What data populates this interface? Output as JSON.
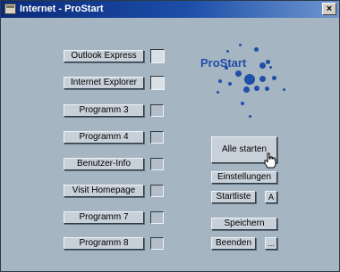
{
  "window": {
    "title": "Internet - ProStart",
    "close_label": "×",
    "icon": "app-window-icon"
  },
  "programs": [
    {
      "label": "Outlook Express",
      "checked": false,
      "checkbox_style": "large"
    },
    {
      "label": "Internet Explorer",
      "checked": false,
      "checkbox_style": "large"
    },
    {
      "label": "Programm 3",
      "checked": false
    },
    {
      "label": "Programm 4",
      "checked": false
    },
    {
      "label": "Benutzer-Info",
      "checked": false
    },
    {
      "label": "Visit Homepage",
      "checked": false
    },
    {
      "label": "Programm 7",
      "checked": false
    },
    {
      "label": "Programm 8",
      "checked": false
    }
  ],
  "logo": {
    "text": "ProStart",
    "color": "#1f4fa8"
  },
  "actions": {
    "start_all": "Alle starten",
    "settings": "Einstellungen",
    "start_list": "Startliste",
    "start_list_mode": "A",
    "save": "Speichern",
    "quit": "Beenden",
    "more": "..."
  },
  "colors": {
    "window_bg": "#a6b5c2",
    "title_gradient_start": "#0b2a7a",
    "title_gradient_end": "#6f96cf",
    "accent": "#1f4fa8"
  }
}
